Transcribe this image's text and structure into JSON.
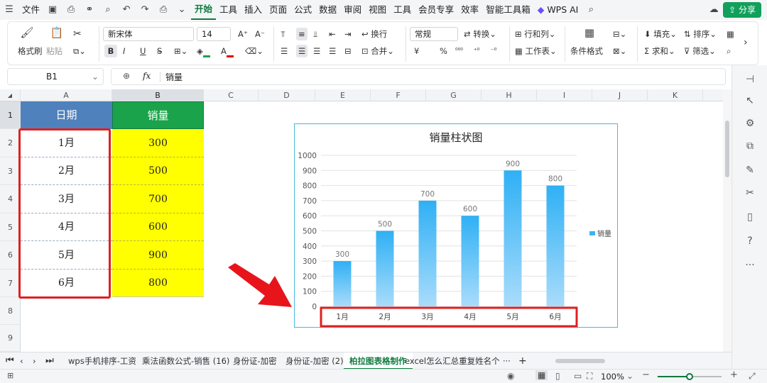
{
  "menubar": {
    "file": "文件",
    "tabs": [
      "开始",
      "工具",
      "插入",
      "页面",
      "公式",
      "数据",
      "审阅",
      "视图",
      "工具",
      "会员专享",
      "效率",
      "智能工具箱"
    ],
    "wps_ai": "WPS AI",
    "share": "分享"
  },
  "ribbon": {
    "format_painter": "格式刷",
    "paste": "粘贴",
    "font_name": "新宋体",
    "font_size": "14",
    "bold": "B",
    "italic": "I",
    "underline": "U",
    "wrap": "换行",
    "merge": "合并",
    "number_format": "常规",
    "convert": "转换",
    "rows_cols": "行和列",
    "worksheet": "工作表",
    "cond_format": "条件格式",
    "fill": "填充",
    "sort": "排序",
    "sum": "求和",
    "filter": "筛选",
    "currency": "¥",
    "percent": "%",
    "font_color": "#e00000",
    "fill_color": "#1aa34a"
  },
  "formulabar": {
    "cellref": "B1",
    "fx": "fx",
    "content": "销量"
  },
  "columns": [
    "A",
    "B",
    "C",
    "D",
    "E",
    "F",
    "G",
    "H",
    "I",
    "J",
    "K"
  ],
  "rows": [
    "1",
    "2",
    "3",
    "4",
    "5",
    "6",
    "7",
    "8",
    "9"
  ],
  "table": {
    "headers": [
      "日期",
      "销量"
    ],
    "dates": [
      "1月",
      "2月",
      "3月",
      "4月",
      "5月",
      "6月"
    ],
    "sales": [
      "300",
      "500",
      "700",
      "600",
      "900",
      "800"
    ],
    "date_header_color": "#4f81bd",
    "sales_header_color": "#1aa34a",
    "sales_fill": "#ffff00"
  },
  "chart_data": {
    "type": "bar",
    "title": "销量柱状图",
    "categories": [
      "1月",
      "2月",
      "3月",
      "4月",
      "5月",
      "6月"
    ],
    "series": [
      {
        "name": "销量",
        "values": [
          300,
          500,
          700,
          600,
          900,
          800
        ]
      }
    ],
    "ylim": [
      0,
      1000
    ],
    "yticks": [
      0,
      100,
      200,
      300,
      400,
      500,
      600,
      700,
      800,
      900,
      1000
    ],
    "grid": true,
    "legend": "right",
    "bar_color": "#3bb4f2"
  },
  "sheets": [
    "wps手机排序-工资",
    "乘法函数公式-销售 (16)",
    "身份证-加密",
    "身份证-加密 (2)",
    "柏拉图表格制作",
    "excel怎么汇总重复姓名个数"
  ],
  "status": {
    "zoom": "100%"
  }
}
